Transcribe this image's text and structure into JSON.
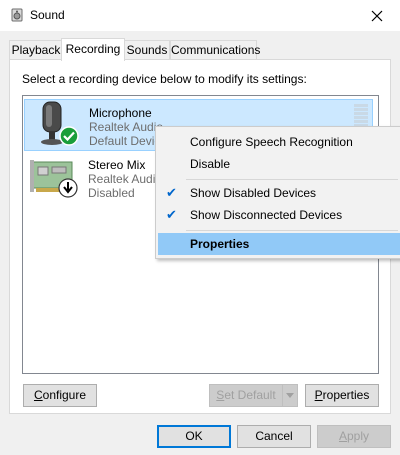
{
  "window": {
    "title": "Sound",
    "close_icon": "close-icon"
  },
  "tabs": [
    {
      "label": "Playback",
      "active": false
    },
    {
      "label": "Recording",
      "active": true
    },
    {
      "label": "Sounds",
      "active": false
    },
    {
      "label": "Communications",
      "active": false
    }
  ],
  "instruction": "Select a recording device below to modify its settings:",
  "devices": [
    {
      "name": "Microphone",
      "driver": "Realtek Audio",
      "status": "Default Devic",
      "icon": "microphone-icon",
      "badge": "default-check-icon",
      "selected": true
    },
    {
      "name": "Stereo Mix",
      "driver": "Realtek Audi",
      "status": "Disabled",
      "icon": "sound-card-icon",
      "badge": "disabled-arrow-icon",
      "selected": false
    }
  ],
  "context_menu": {
    "items": [
      {
        "label": "Configure Speech Recognition",
        "checked": false
      },
      {
        "label": "Disable",
        "checked": false
      },
      {
        "label": "Show Disabled Devices",
        "checked": true
      },
      {
        "label": "Show Disconnected Devices",
        "checked": true
      },
      {
        "label": "Properties",
        "checked": false,
        "highlighted": true,
        "bold": true
      }
    ]
  },
  "buttons": {
    "configure": {
      "underline": "C",
      "rest": "onfigure"
    },
    "set_default": {
      "underline": "S",
      "rest": "et Default",
      "disabled": true
    },
    "properties": {
      "underline": "P",
      "rest": "roperties"
    },
    "ok": "OK",
    "cancel": "Cancel",
    "apply": {
      "underline": "A",
      "rest": "pply",
      "disabled": true
    }
  },
  "colors": {
    "selection": "#cce8ff",
    "menu_highlight": "#91c9f7",
    "accent": "#0078d7"
  }
}
